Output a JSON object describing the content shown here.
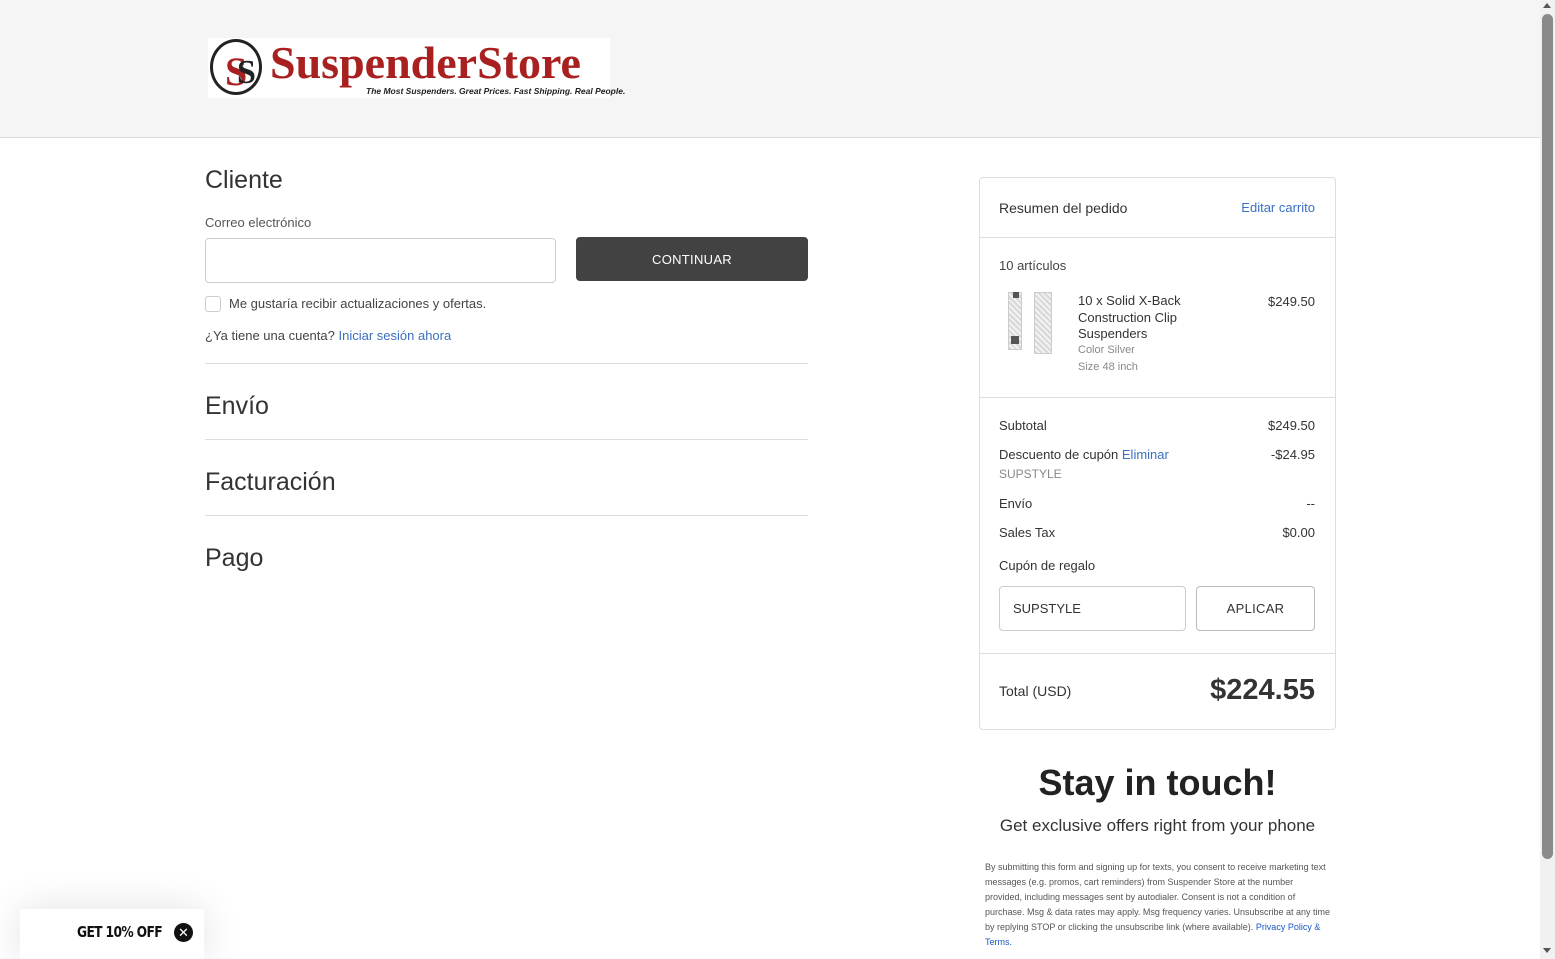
{
  "header": {
    "logo_text": "SuspenderStore",
    "logo_tagline": "The Most Suspenders. Great Prices. Fast Shipping. Real People."
  },
  "checkout": {
    "customer_title": "Cliente",
    "email_label": "Correo electrónico",
    "email_value": "",
    "continue_label": "CONTINUAR",
    "newsletter_label": "Me gustaría recibir actualizaciones y ofertas.",
    "account_prompt": "¿Ya tiene una cuenta?",
    "sign_in_link": "Iniciar sesión ahora",
    "shipping_title": "Envío",
    "billing_title": "Facturación",
    "payment_title": "Pago"
  },
  "summary": {
    "title": "Resumen del pedido",
    "edit_cart": "Editar carrito",
    "item_count": "10 artículos",
    "item": {
      "name": "10 x Solid X-Back Construction Clip Suspenders",
      "price": "$249.50",
      "color": "Color Silver",
      "size": "Size 48 inch"
    },
    "subtotal_label": "Subtotal",
    "subtotal_value": "$249.50",
    "discount_label": "Descuento de cupón",
    "discount_remove": "Eliminar",
    "discount_value": "-$24.95",
    "discount_code": "SUPSTYLE",
    "shipping_label": "Envío",
    "shipping_value": "--",
    "tax_label": "Sales Tax",
    "tax_value": "$0.00",
    "gift_label": "Cupón de regalo",
    "gift_input_value": "SUPSTYLE",
    "apply_label": "APLICAR",
    "total_label": "Total (USD)",
    "total_value": "$224.55"
  },
  "stay": {
    "title": "Stay in touch!",
    "subtitle": "Get exclusive offers right from your phone",
    "legal": "By submitting this form and signing up for texts, you consent to receive marketing text messages (e.g. promos, cart reminders) from Suspender Store at the number provided, including messages sent by autodialer. Consent is not a condition of purchase. Msg & data rates may apply. Msg frequency varies. Unsubscribe at any time by replying STOP or clicking the unsubscribe link (where available).",
    "policy_link": "Privacy Policy & Terms."
  },
  "promo": {
    "label": "GET 10% OFF",
    "close_glyph": "✕"
  },
  "colors": {
    "brand_red": "#a82020",
    "link_blue": "#3b6fc2",
    "button_dark": "#424242"
  }
}
